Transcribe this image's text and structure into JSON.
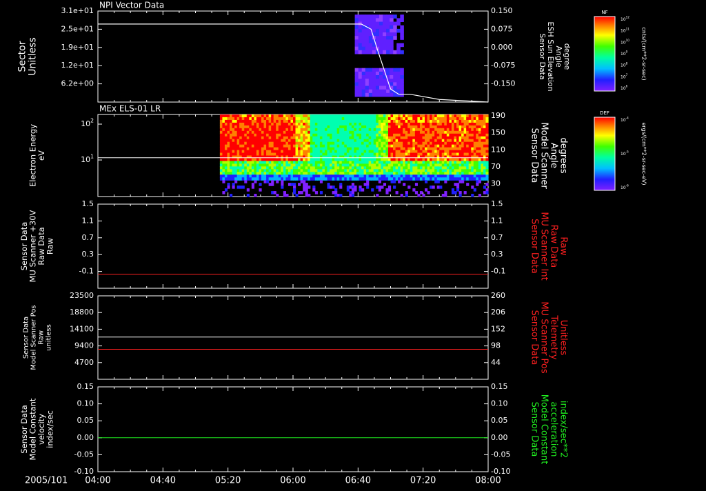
{
  "colors": {
    "background": "#000000",
    "axis": "#ffffff",
    "red": "#ff2020",
    "green": "#20ee20"
  },
  "time_axis": {
    "date_label": "2005/101",
    "ticks": [
      "04:00",
      "04:40",
      "05:20",
      "06:00",
      "06:40",
      "07:20",
      "08:00"
    ]
  },
  "colorbars": [
    {
      "label": "NF",
      "unit": "cnts/(cm**2-sr-sec)",
      "tick_labels": [
        "10^12",
        "10^11",
        "10^10",
        "10^9",
        "10^8",
        "10^7",
        "10^6"
      ]
    },
    {
      "label": "DEF",
      "unit": "ergs/(cm**2-sr-sec-eV)",
      "tick_labels": [
        "10^-4",
        "10^-5",
        "10^-6"
      ]
    }
  ],
  "panels": [
    {
      "title": "NPI Vector Data",
      "left_label": [
        "Sector",
        "Unitless"
      ],
      "right_label": [
        "Sensor Data",
        "ESH Sun Elevation",
        "Angle",
        "degree"
      ],
      "left_ticks": [
        "3.1e+01",
        "2.5e+01",
        "1.9e+01",
        "1.2e+01",
        "6.2e+00"
      ],
      "right_ticks": [
        "0.150",
        "0.075",
        "0.000",
        "-0.075",
        "-0.150"
      ]
    },
    {
      "title": "MEx ELS-01 LR",
      "left_label": [
        "Electron Energy",
        "eV"
      ],
      "right_label": [
        "Sensor Data",
        "Model Scanner",
        "Angle",
        "degrees"
      ],
      "left_ticks": [
        "10^2",
        "10^1"
      ],
      "right_ticks": [
        "190",
        "150",
        "110",
        "70",
        "30"
      ]
    },
    {
      "title": "",
      "left_label": [
        "Sensor Data",
        "MU Scanner +30V",
        "Raw Data",
        "Raw"
      ],
      "right_label": [
        "Sensor Data",
        "MU Scanner Int",
        "Raw Data",
        "Raw"
      ],
      "left_ticks": [
        "1.5",
        "1.1",
        "0.7",
        "0.3",
        "-0.1"
      ],
      "right_ticks": [
        "1.5",
        "1.1",
        "0.7",
        "0.3",
        "-0.1"
      ]
    },
    {
      "title": "",
      "left_label": [
        "Sensor Data",
        "Model Scanner Pos",
        "Raw",
        "unitless"
      ],
      "right_label": [
        "Sensor Data",
        "MU Scanner Pos",
        "Telemetry",
        "Unitless"
      ],
      "left_ticks": [
        "23500",
        "18800",
        "14100",
        "9400",
        "4700"
      ],
      "right_ticks": [
        "260",
        "206",
        "152",
        "98",
        "44"
      ]
    },
    {
      "title": "",
      "left_label": [
        "Sensor Data",
        "Model Constant",
        "velocity",
        "index/sec"
      ],
      "right_label": [
        "Sensor Data",
        "Model Constant",
        "acceleration",
        "index/sec**2"
      ],
      "left_ticks": [
        "0.15",
        "0.10",
        "0.05",
        "0.00",
        "-0.05",
        "-0.10"
      ],
      "right_ticks": [
        "0.15",
        "0.10",
        "0.05",
        "0.00",
        "-0.05",
        "-0.10"
      ]
    }
  ],
  "chart_data": [
    {
      "type": "line",
      "title": "NPI Vector Data",
      "description_series": "ESH Sun Elevation Angle",
      "x": [
        "04:00",
        "06:38",
        "06:42",
        "06:48",
        "06:52",
        "07:00",
        "07:05",
        "07:12",
        "07:30",
        "08:00"
      ],
      "series": [
        {
          "name": "ESH Sun Elevation Angle",
          "values": [
            0.1,
            0.1,
            0.1,
            0.08,
            0.0,
            -0.15,
            -0.17,
            -0.17,
            -0.19,
            -0.2
          ]
        }
      ],
      "heatmap_extent": {
        "x": [
          "06:38",
          "07:08"
        ],
        "ylim": [
          0,
          31
        ]
      },
      "ylim_left": [
        0,
        31
      ],
      "ylim_right": [
        -0.2,
        0.15
      ]
    },
    {
      "type": "heatmap",
      "title": "MEx ELS-01 LR",
      "xlabel": "",
      "ylabel": "Electron Energy eV",
      "data_start": "05:15",
      "data_end": "08:00",
      "yscale": "log",
      "line": {
        "name": "Model Scanner Angle",
        "value": 95
      },
      "ylim_right": [
        10,
        190
      ]
    },
    {
      "type": "line",
      "series": [
        {
          "name": "MU Scanner Int",
          "values": [
            0.0,
            0.0
          ]
        }
      ],
      "x": [
        "04:00",
        "08:00"
      ],
      "ylim": [
        -0.3,
        1.5
      ]
    },
    {
      "type": "line",
      "x": [
        "04:00",
        "08:00"
      ],
      "series": [
        {
          "name": "Model Scanner Pos",
          "values": [
            11900,
            11900
          ]
        },
        {
          "name": "MU Scanner Pos",
          "values": [
            87,
            87
          ]
        }
      ],
      "ylim_left": [
        0,
        23500
      ],
      "ylim_right": [
        -10,
        260
      ]
    },
    {
      "type": "line",
      "x": [
        "04:00",
        "08:00"
      ],
      "series": [
        {
          "name": "Model Constant acceleration",
          "values": [
            0.0,
            0.0
          ]
        }
      ],
      "ylim": [
        -0.1,
        0.15
      ]
    }
  ]
}
